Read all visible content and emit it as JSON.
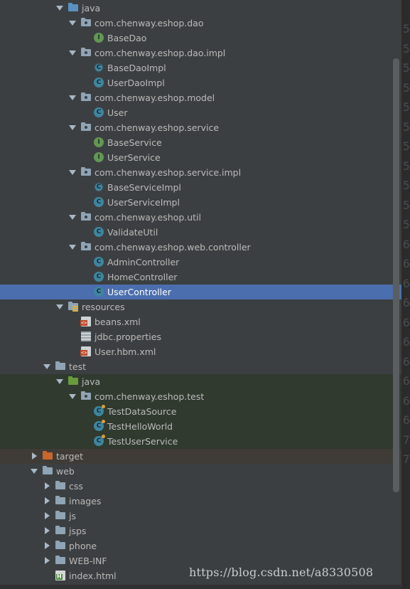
{
  "tree": [
    {
      "label": "java",
      "kind": "folder-src",
      "expanded": true,
      "depth": 4
    },
    {
      "label": "com.chenway.eshop.dao",
      "kind": "package",
      "expanded": true,
      "depth": 5
    },
    {
      "label": "BaseDao",
      "kind": "interface",
      "depth": 6
    },
    {
      "label": "com.chenway.eshop.dao.impl",
      "kind": "package",
      "expanded": true,
      "depth": 5
    },
    {
      "label": "BaseDaoImpl",
      "kind": "abstract-class",
      "depth": 6
    },
    {
      "label": "UserDaoImpl",
      "kind": "class",
      "depth": 6
    },
    {
      "label": "com.chenway.eshop.model",
      "kind": "package",
      "expanded": true,
      "depth": 5
    },
    {
      "label": "User",
      "kind": "class",
      "depth": 6
    },
    {
      "label": "com.chenway.eshop.service",
      "kind": "package",
      "expanded": true,
      "depth": 5
    },
    {
      "label": "BaseService",
      "kind": "interface",
      "depth": 6
    },
    {
      "label": "UserService",
      "kind": "interface",
      "depth": 6
    },
    {
      "label": "com.chenway.eshop.service.impl",
      "kind": "package",
      "expanded": true,
      "depth": 5
    },
    {
      "label": "BaseServiceImpl",
      "kind": "abstract-class",
      "depth": 6
    },
    {
      "label": "UserServiceImpl",
      "kind": "class",
      "depth": 6
    },
    {
      "label": "com.chenway.eshop.util",
      "kind": "package",
      "expanded": true,
      "depth": 5
    },
    {
      "label": "ValidateUtil",
      "kind": "class",
      "depth": 6
    },
    {
      "label": "com.chenway.eshop.web.controller",
      "kind": "package",
      "expanded": true,
      "depth": 5
    },
    {
      "label": "AdminController",
      "kind": "class",
      "depth": 6
    },
    {
      "label": "HomeController",
      "kind": "class",
      "depth": 6
    },
    {
      "label": "UserController",
      "kind": "class",
      "depth": 6,
      "selected": true
    },
    {
      "label": "resources",
      "kind": "folder-res",
      "expanded": true,
      "depth": 4
    },
    {
      "label": "beans.xml",
      "kind": "xml",
      "depth": 5
    },
    {
      "label": "jdbc.properties",
      "kind": "props",
      "depth": 5
    },
    {
      "label": "User.hbm.xml",
      "kind": "xml",
      "depth": 5
    },
    {
      "label": "test",
      "kind": "folder",
      "expanded": true,
      "depth": 3
    },
    {
      "label": "java",
      "kind": "folder-test",
      "expanded": true,
      "depth": 4,
      "test": true
    },
    {
      "label": "com.chenway.eshop.test",
      "kind": "package",
      "expanded": true,
      "depth": 5,
      "test": true
    },
    {
      "label": "TestDataSource",
      "kind": "test-class",
      "depth": 6,
      "test": true
    },
    {
      "label": "TestHelloWorld",
      "kind": "test-class",
      "depth": 6,
      "test": true
    },
    {
      "label": "TestUserService",
      "kind": "test-class",
      "depth": 6,
      "test": true
    },
    {
      "label": "target",
      "kind": "folder-excluded",
      "expanded": false,
      "depth": 2,
      "excluded": true
    },
    {
      "label": "web",
      "kind": "folder",
      "expanded": true,
      "depth": 2
    },
    {
      "label": "css",
      "kind": "folder",
      "expanded": false,
      "depth": 3
    },
    {
      "label": "images",
      "kind": "folder",
      "expanded": false,
      "depth": 3
    },
    {
      "label": "js",
      "kind": "folder",
      "expanded": false,
      "depth": 3
    },
    {
      "label": "jsps",
      "kind": "folder",
      "expanded": false,
      "depth": 3
    },
    {
      "label": "phone",
      "kind": "folder",
      "expanded": false,
      "depth": 3
    },
    {
      "label": "WEB-INF",
      "kind": "folder",
      "expanded": false,
      "depth": 3
    },
    {
      "label": "index.html",
      "kind": "html",
      "depth": 3
    }
  ],
  "gutter_digits": [
    "5",
    "5",
    "5",
    "5",
    "5",
    "5",
    "5",
    "5",
    "5",
    "5",
    "5",
    "6",
    "6",
    "6",
    "6",
    "6",
    "6",
    "6",
    "6",
    "6",
    "6",
    "7",
    "7"
  ],
  "watermark": "https://blog.csdn.net/a8330508",
  "colors": {
    "background": "#3c3f41",
    "selection": "#4b6eaf",
    "test_background": "#303a2f",
    "excluded_background": "#3f3c37"
  }
}
